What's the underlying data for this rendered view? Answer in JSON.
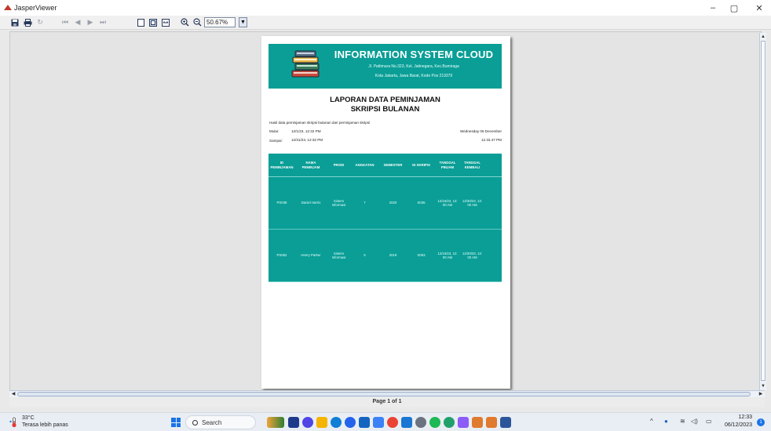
{
  "window": {
    "title": "JasperViewer",
    "minimize": "–",
    "maximize": "▢",
    "close": "✕"
  },
  "toolbar": {
    "zoom_value": "50.67%"
  },
  "report": {
    "banner_title": "INFORMATION SYSTEM CLOUD",
    "address_line1": "Jl. Pattimura No.323, Kel. Jatinegara, Kec.Bumiraga",
    "address_line2": "Kota Jakarta, Jawa Barat, Kode Pos 219379",
    "title_line1": "LAPORAN DATA PEMINJAMAN",
    "title_line2": "SKRIPSI BULANAN",
    "description": "Hasil data peminjaman skripsi bulanan dari peminjaman skripsi",
    "mulai_label": "Mulai:",
    "mulai_value": "12/1/23, 12:32 PM",
    "sampai_label": "Sampai:",
    "sampai_value": "12/31/23, 12:32 PM",
    "print_date": "Wednesday 06 December",
    "print_time": "12.33.47 PM",
    "columns": [
      [
        "ID",
        "PEMINJAMAN"
      ],
      [
        "NAMA",
        "PEMINJAM"
      ],
      [
        "PRODI",
        ""
      ],
      [
        "ANGKATAN",
        ""
      ],
      [
        "SEMESTER",
        ""
      ],
      [
        "ID SKRIPSI",
        ""
      ],
      [
        "TANGGAL",
        "PINJAM"
      ],
      [
        "TANGGAL",
        "KEMBALI"
      ]
    ],
    "rows": [
      {
        "id": "PS038",
        "nama": "Daniel Harris",
        "prodi1": "Sistem",
        "prodi2": "Informasi",
        "angkatan": "7",
        "semester": "2020",
        "id_skripsi": "S036",
        "pinjam1": "12/15/23, 12:",
        "pinjam2": "00 AM",
        "kembali1": "12/30/23, 12:",
        "kembali2": "00 AM"
      },
      {
        "id": "PS062",
        "nama": "Henry Parker",
        "prodi1": "Sistem",
        "prodi2": "Informasi",
        "angkatan": "5",
        "semester": "2019",
        "id_skripsi": "S063",
        "pinjam1": "12/15/23, 12:",
        "pinjam2": "00 AM",
        "kembali1": "12/30/23, 12:",
        "kembali2": "00 AM"
      }
    ]
  },
  "pager": {
    "indicator": "Page 1 of 1"
  },
  "taskbar": {
    "temp": "33°C",
    "weather_desc": "Terasa lebih panas",
    "search_label": "Search",
    "time": "12:33",
    "date": "06/12/2023",
    "notif_count": "1",
    "colors": {
      "accent": "#1a73e8",
      "teal": "#0a9e96"
    }
  }
}
